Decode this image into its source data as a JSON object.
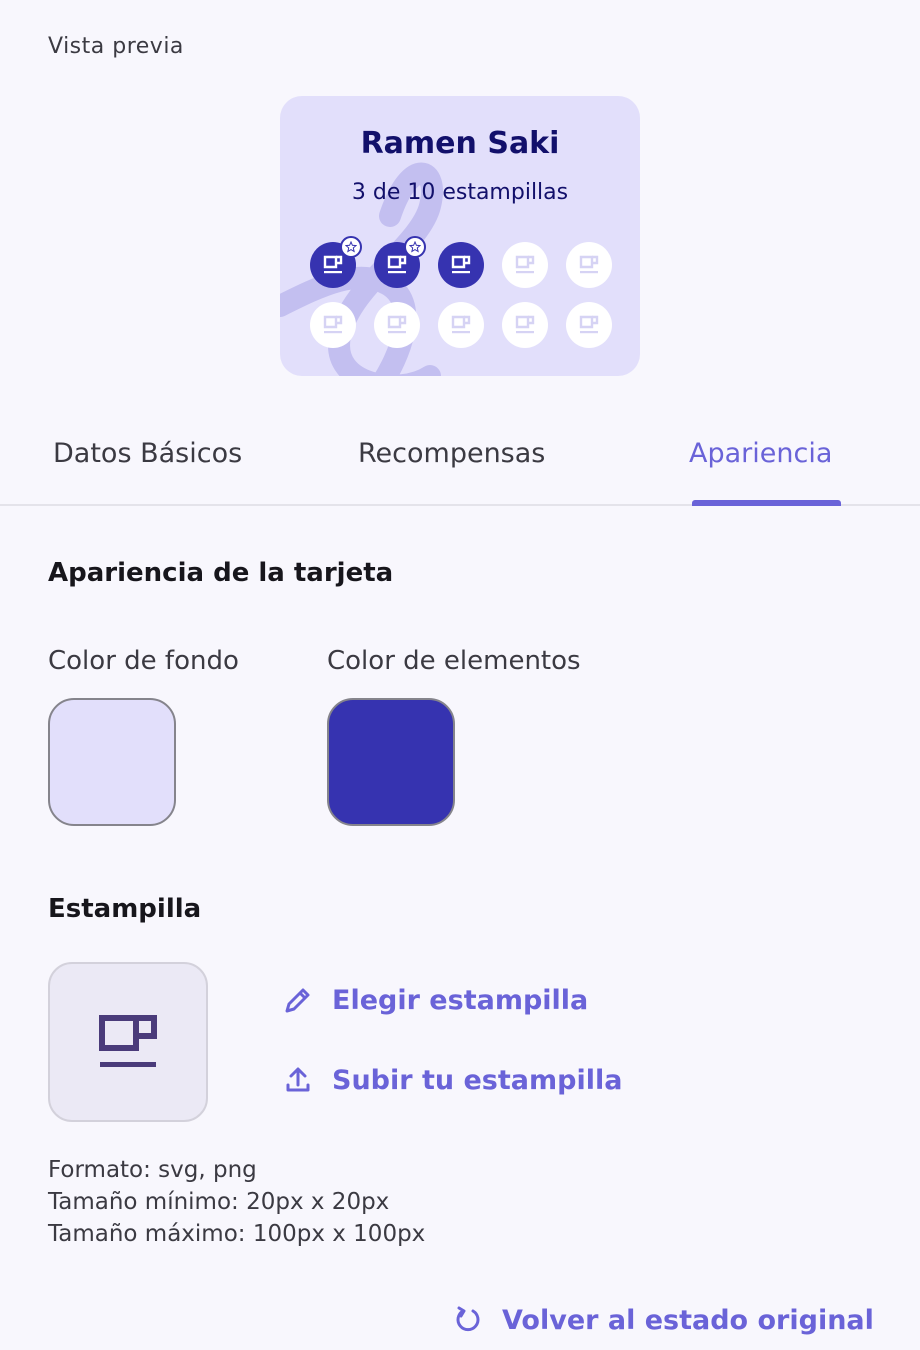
{
  "preview": {
    "label": "Vista previa"
  },
  "card": {
    "name": "Ramen Saki",
    "count_text": "3 de 10 estampillas",
    "background_color": "#e2dffb",
    "element_color": "#3633b0",
    "stamps_total": 10,
    "stamps_filled": 3,
    "stamp_icon": "coffee-cup-icon",
    "badge_icon": "star-badge-icon"
  },
  "tabs": [
    {
      "label": "Datos Básicos",
      "active": false
    },
    {
      "label": "Recompensas",
      "active": false
    },
    {
      "label": "Apariencia",
      "active": true
    }
  ],
  "appearance": {
    "title": "Apariencia de la tarjeta",
    "background_label": "Color de fondo",
    "background_value": "#e2dffb",
    "elements_label": "Color de elementos",
    "elements_value": "#3633b0"
  },
  "stamp": {
    "title": "Estampilla",
    "icon": "coffee-cup-icon",
    "choose_label": "Elegir estampilla",
    "upload_label": "Subir tu estampilla",
    "format": "Formato: svg, png",
    "min_size": "Tamaño mínimo: 20px x 20px",
    "max_size": "Tamaño máximo: 100px x 100px"
  },
  "reset": {
    "label": "Volver al estado original"
  },
  "colors": {
    "accent": "#6a63d8",
    "primary_dark": "#12106b"
  }
}
